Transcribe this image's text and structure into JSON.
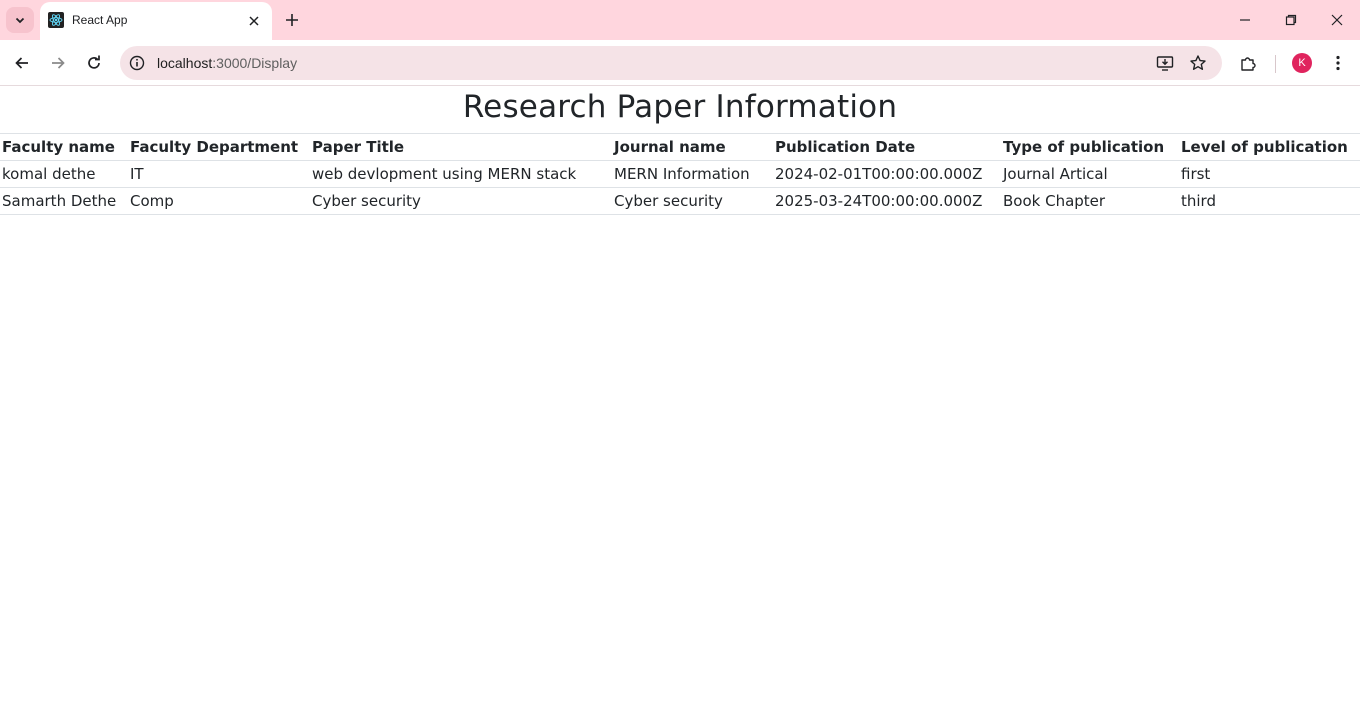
{
  "browser": {
    "tab_title": "React App",
    "url_host": "localhost",
    "url_path": ":3000/Display",
    "profile_initial": "K",
    "accent_color": "#ffd6de"
  },
  "page": {
    "title": "Research Paper Information"
  },
  "table": {
    "headers": [
      "Faculty name",
      "Faculty Department",
      "Paper Title",
      "Journal name",
      "Publication Date",
      "Type of publication",
      "Level of publication"
    ],
    "rows": [
      [
        "komal dethe",
        "IT",
        "web devlopment using MERN stack",
        "MERN Information",
        "2024-02-01T00:00:00.000Z",
        "Journal Artical",
        "first"
      ],
      [
        "Samarth Dethe",
        "Comp",
        "Cyber security",
        "Cyber security",
        "2025-03-24T00:00:00.000Z",
        "Book Chapter",
        "third"
      ]
    ]
  },
  "icons": {
    "tab_search": "chevron-down-icon",
    "favicon": "react-logo-icon",
    "tab_close": "close-icon",
    "new_tab": "plus-icon",
    "minimize": "minimize-icon",
    "restore": "restore-icon",
    "close_window": "close-icon",
    "back": "arrow-left-icon",
    "forward": "arrow-right-icon",
    "reload": "reload-icon",
    "site_info": "info-icon",
    "install_app": "install-icon",
    "bookmark": "star-icon",
    "extensions": "puzzle-icon",
    "menu": "kebab-menu-icon"
  }
}
